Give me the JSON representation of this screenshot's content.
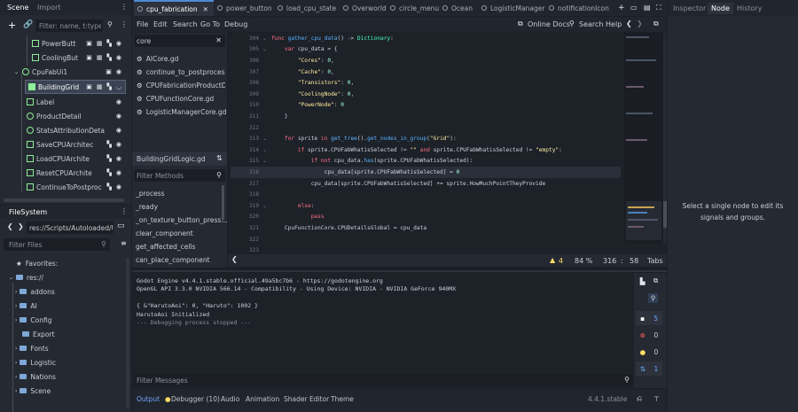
{
  "left_dock": {
    "tabs": [
      "Scene",
      "Import"
    ],
    "filter_placeholder": "Filter: name, t:type, g",
    "scene_nodes": [
      {
        "label": "PowerButt",
        "icon": "texture-button-icon"
      },
      {
        "label": "CoolingBut",
        "icon": "texture-button-icon"
      },
      {
        "label": "CpuFabUi1",
        "icon": "control-icon"
      },
      {
        "label": "BuildingGrid",
        "icon": "grid-container-icon"
      },
      {
        "label": "Label",
        "icon": "label-icon"
      },
      {
        "label": "ProductDetail",
        "icon": "control-icon"
      },
      {
        "label": "StatsAttributionDeta",
        "icon": "control-icon"
      },
      {
        "label": "SaveCPUArchitec",
        "icon": "texture-button-icon"
      },
      {
        "label": "LoadCPUArchite",
        "icon": "texture-button-icon"
      },
      {
        "label": "ResetCPUArchite",
        "icon": "texture-button-icon"
      },
      {
        "label": "ContinueToPostproc",
        "icon": "texture-button-icon"
      }
    ],
    "filesystem": {
      "title": "FileSystem",
      "path": "res://Scripts/Autoloaded/Ut",
      "filter_placeholder": "Filter Files",
      "favorites_label": "Favorites:",
      "root_label": "res://",
      "folders": [
        "addons",
        "AI",
        "Config",
        "Export",
        "Fonts",
        "Logistic",
        "Nations",
        "Scene"
      ]
    }
  },
  "top_tabs": [
    "cpu_fabrication",
    "power_button",
    "load_cpu_state",
    "Overworld",
    "circle_menu",
    "Ocean",
    "LogisticManager",
    "notificationIcon"
  ],
  "right_tabs": [
    "Inspector",
    "Node",
    "History"
  ],
  "node_panel_message": "Select a single node to edit its signals and groups.",
  "menu": {
    "items": [
      "File",
      "Edit",
      "Search",
      "Go To",
      "Debug"
    ],
    "online_docs": "Online Docs",
    "search_help": "Search Help"
  },
  "script_panel": {
    "filter_value": "core",
    "scripts": [
      "AICore.gd",
      "continue_to_postprocessi...",
      "CPUFabricationProductD...",
      "CPUFunctionCore.gd",
      "LogisticManagerCore.gd"
    ],
    "current_script": "BuildingGridLogic.gd",
    "filter_methods_placeholder": "Filter Methods",
    "methods": [
      "_process",
      "_ready",
      "_on_texture_button_press...",
      "clear_component",
      "get_affected_cells",
      "can_place_component"
    ]
  },
  "code": {
    "lines": [
      {
        "n": "304",
        "fold": true,
        "text": "func gather_cpu_data() -> Dictionary:"
      },
      {
        "n": "305",
        "fold": true,
        "text": "    var cpu_data = {"
      },
      {
        "n": "306",
        "fold": false,
        "text": "        \"Cores\": 0,"
      },
      {
        "n": "307",
        "fold": false,
        "text": "        \"Cache\": 0,"
      },
      {
        "n": "308",
        "fold": false,
        "text": "        \"Transistors\": 0,"
      },
      {
        "n": "309",
        "fold": false,
        "text": "        \"CoolingNode\": 0,"
      },
      {
        "n": "310",
        "fold": false,
        "text": "        \"PowerNode\": 0"
      },
      {
        "n": "311",
        "fold": false,
        "text": "    }"
      },
      {
        "n": "312",
        "fold": false,
        "text": ""
      },
      {
        "n": "313",
        "fold": true,
        "text": "    for sprite in get_tree().get_nodes_in_group(\"Grid\"):"
      },
      {
        "n": "314",
        "fold": true,
        "text": "        if sprite.CPUFabWhatisSelected != \"\" and sprite.CPUFabWhatisSelected != \"empty\":"
      },
      {
        "n": "315",
        "fold": true,
        "text": "            if not cpu_data.has(sprite.CPUFabWhatisSelected):"
      },
      {
        "n": "316",
        "fold": false,
        "text": "                cpu_data[sprite.CPUFabWhatisSelected] = 0"
      },
      {
        "n": "317",
        "fold": false,
        "text": "            cpu_data[sprite.CPUFabWhatisSelected] += sprite.HowMuchPointTheyProvide"
      },
      {
        "n": "318",
        "fold": false,
        "text": ""
      },
      {
        "n": "319",
        "fold": true,
        "text": "        else:"
      },
      {
        "n": "320",
        "fold": false,
        "text": "            pass"
      },
      {
        "n": "321",
        "fold": false,
        "text": "    CpuFunctionCore.CPUDetailsGlobal = cpu_data"
      },
      {
        "n": "322",
        "fold": false,
        "text": ""
      },
      {
        "n": "323",
        "fold": false,
        "text": ""
      }
    ],
    "status": {
      "warnings": "4",
      "zoom": "84 %",
      "line": "316",
      "col": "58",
      "indent": "Tabs"
    }
  },
  "output": {
    "lines": [
      "Godot Engine v4.4.1.stable.official.49a5bc7b6 - https://godotengine.org",
      "OpenGL API 3.3.0 NVIDIA 566.14 - Compatibility - Using Device: NVIDIA - NVIDIA GeForce 940MX",
      "",
      "{ &\"HarutoAoi\": 0, \"Haruto\": 1002 }",
      "HarutoAoi Initialized",
      "--- Debugging process stopped ---"
    ],
    "filter_placeholder": "Filter Messages",
    "counts": {
      "messages": "5",
      "errors": "0",
      "warnings": "0",
      "info": "1"
    }
  },
  "bottom_tabs": [
    "Output",
    "Debugger (10)",
    "Audio",
    "Animation",
    "Shader Editor",
    "Theme"
  ],
  "version": "4.4.1.stable",
  "colors": {
    "accent": "#4e8ad6",
    "warning": "#ffdd65",
    "error": "#ff5d5d",
    "info": "#6ea8ff"
  }
}
